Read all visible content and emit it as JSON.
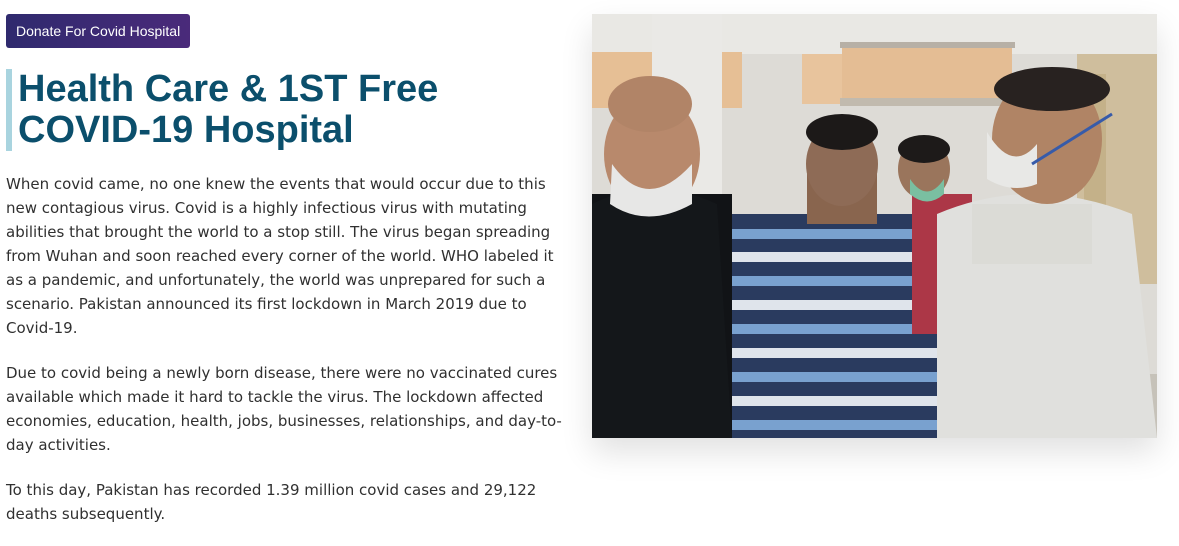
{
  "donate_button": {
    "label": "Donate For Covid Hospital"
  },
  "heading": {
    "line1": "Health Care & 1ST Free",
    "line2": "COVID-19 Hospital"
  },
  "paragraphs": [
    "When covid came, no one knew the events that would occur due to this new contagious virus. Covid is a highly infectious virus with mutating abilities that brought the world to a stop still. The virus began spreading from Wuhan and soon reached every corner of the world. WHO labeled it as a pandemic, and unfortunately, the world was unprepared for such a scenario. Pakistan announced its first lockdown in March 2019 due to Covid-19.",
    "Due to covid being a newly born disease, there were no vaccinated cures available which made it hard to tackle the virus. The lockdown affected economies, education, health, jobs, businesses, relationships, and day-to-day activities.",
    "To this day, Pakistan has recorded 1.39 million covid cases and 29,122 deaths subsequently."
  ],
  "colors": {
    "button_bg": "#3a2a6b",
    "heading": "#0b4f6c",
    "heading_accent_bar": "#a9d4df",
    "body_text": "#303030"
  }
}
